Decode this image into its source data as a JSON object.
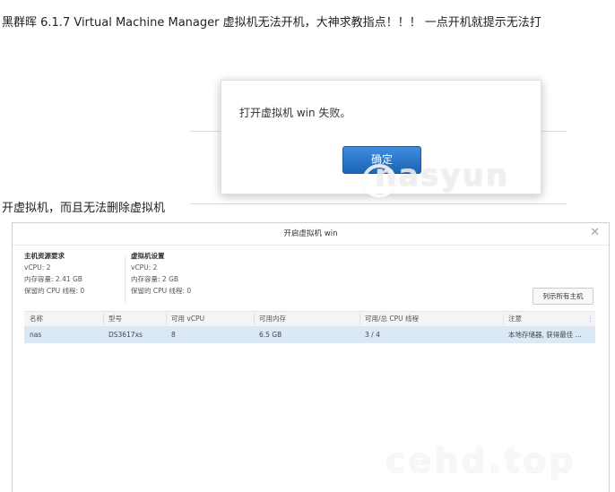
{
  "post": {
    "title_line": "黑群晖 6.1.7   Virtual Machine Manager  虚拟机无法开机，大神求教指点！！！ 一点开机就提示无法打",
    "second_line": "开虚拟机，而且无法删除虚拟机"
  },
  "dialog": {
    "message": "打开虚拟机 win 失败。",
    "ok_label": "确定"
  },
  "watermarks": [
    "nasyun",
    "cehd.top"
  ],
  "window": {
    "title": "开启虚拟机 win",
    "close_icon": "close-icon",
    "host": {
      "header": "主机资源要求",
      "lines": [
        "vCPU:  2",
        "内存容量:  2.41 GB",
        "保留的 CPU 线程:  0"
      ]
    },
    "vm": {
      "header": "虚拟机设置",
      "lines": [
        "vCPU:  2",
        "内存容量:  2 GB",
        "保留的 CPU 线程:  0"
      ]
    },
    "list_button": "列示所有主机",
    "table": {
      "columns": [
        "名称",
        "型号",
        "可用 vCPU",
        "可用内存",
        "可用/总 CPU 线程",
        "注意"
      ],
      "rows": [
        [
          "nas",
          "DS3617xs",
          "8",
          "6.5 GB",
          "3 / 4",
          "本地存储器, 获得最佳 ..."
        ]
      ]
    }
  }
}
